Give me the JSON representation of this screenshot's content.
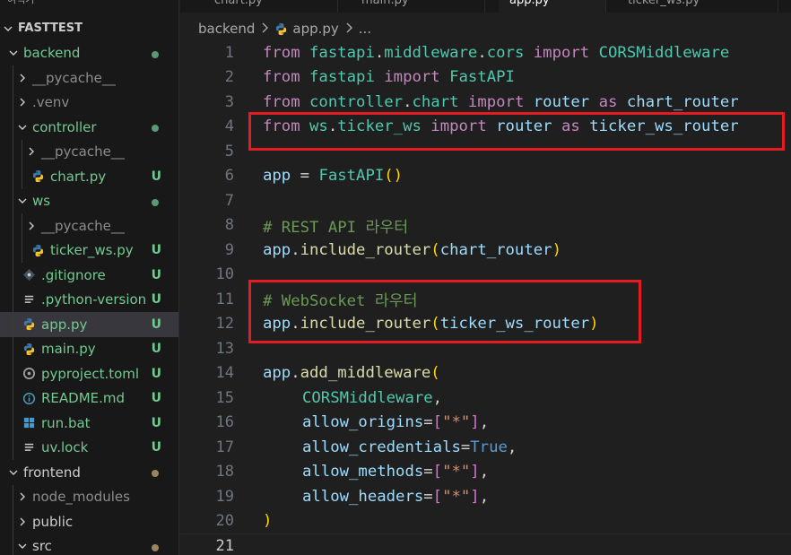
{
  "sidebar": {
    "top_partial": "여택기",
    "items": [
      {
        "label": "FASTTEST",
        "kind": "root",
        "depth": 0,
        "expanded": true
      },
      {
        "label": "backend",
        "kind": "folder",
        "depth": 1,
        "expanded": true,
        "badge": "dot"
      },
      {
        "label": "__pycache__",
        "kind": "folder",
        "depth": 2,
        "expanded": false,
        "style": "ignored"
      },
      {
        "label": ".venv",
        "kind": "folder",
        "depth": 2,
        "expanded": false,
        "style": "ignored"
      },
      {
        "label": "controller",
        "kind": "folder",
        "depth": 2,
        "expanded": true,
        "badge": "dot"
      },
      {
        "label": "__pycache__",
        "kind": "folder",
        "depth": 3,
        "expanded": false,
        "style": "ignored"
      },
      {
        "label": "chart.py",
        "kind": "python",
        "depth": 3,
        "badge": "U"
      },
      {
        "label": "ws",
        "kind": "folder",
        "depth": 2,
        "expanded": true,
        "badge": "dot"
      },
      {
        "label": "__pycache__",
        "kind": "folder",
        "depth": 3,
        "expanded": false,
        "style": "ignored"
      },
      {
        "label": "ticker_ws.py",
        "kind": "python",
        "depth": 3,
        "badge": "U"
      },
      {
        "label": ".gitignore",
        "kind": "gitignore",
        "depth": 2,
        "badge": "U"
      },
      {
        "label": ".python-version",
        "kind": "text",
        "depth": 2,
        "badge": "U"
      },
      {
        "label": "app.py",
        "kind": "python",
        "depth": 2,
        "badge": "U",
        "selected": true
      },
      {
        "label": "main.py",
        "kind": "python",
        "depth": 2,
        "badge": "U"
      },
      {
        "label": "pyproject.toml",
        "kind": "toml",
        "depth": 2,
        "badge": "U"
      },
      {
        "label": "README.md",
        "kind": "info",
        "depth": 2,
        "badge": "U"
      },
      {
        "label": "run.bat",
        "kind": "windows",
        "depth": 2,
        "badge": "U"
      },
      {
        "label": "uv.lock",
        "kind": "text",
        "depth": 2,
        "badge": "U"
      },
      {
        "label": "frontend",
        "kind": "folder",
        "depth": 1,
        "expanded": true,
        "badge": "dot-brown",
        "style": "plain"
      },
      {
        "label": "node_modules",
        "kind": "folder",
        "depth": 2,
        "expanded": false,
        "style": "ignored"
      },
      {
        "label": "public",
        "kind": "folder",
        "depth": 2,
        "expanded": false,
        "style": "plain"
      },
      {
        "label": "src",
        "kind": "folder",
        "depth": 2,
        "expanded": true,
        "badge": "dot-brown",
        "style": "plain"
      }
    ]
  },
  "tabs": [
    {
      "label": "chart.py",
      "active": false
    },
    {
      "label": "main.py",
      "active": false
    },
    {
      "label": "app.py",
      "active": true
    },
    {
      "label": "ticker_ws.py",
      "active": false
    }
  ],
  "breadcrumb": {
    "folder": "backend",
    "file": "app.py",
    "more": "..."
  },
  "editor": {
    "current_line": 21,
    "lines": [
      [
        [
          "kw",
          "from"
        ],
        [
          "plain",
          " "
        ],
        [
          "mod",
          "fastapi"
        ],
        [
          "op",
          "."
        ],
        [
          "mod",
          "middleware"
        ],
        [
          "op",
          "."
        ],
        [
          "mod",
          "cors"
        ],
        [
          "plain",
          " "
        ],
        [
          "kw",
          "import"
        ],
        [
          "plain",
          " "
        ],
        [
          "cls",
          "CORSMiddleware"
        ]
      ],
      [
        [
          "kw",
          "from"
        ],
        [
          "plain",
          " "
        ],
        [
          "mod",
          "fastapi"
        ],
        [
          "plain",
          " "
        ],
        [
          "kw",
          "import"
        ],
        [
          "plain",
          " "
        ],
        [
          "cls",
          "FastAPI"
        ]
      ],
      [
        [
          "kw",
          "from"
        ],
        [
          "plain",
          " "
        ],
        [
          "mod",
          "controller"
        ],
        [
          "op",
          "."
        ],
        [
          "mod",
          "chart"
        ],
        [
          "plain",
          " "
        ],
        [
          "kw",
          "import"
        ],
        [
          "plain",
          " "
        ],
        [
          "var",
          "router"
        ],
        [
          "plain",
          " "
        ],
        [
          "kw",
          "as"
        ],
        [
          "plain",
          " "
        ],
        [
          "var",
          "chart_router"
        ]
      ],
      [
        [
          "kw",
          "from"
        ],
        [
          "plain",
          " "
        ],
        [
          "mod",
          "ws"
        ],
        [
          "op",
          "."
        ],
        [
          "mod",
          "ticker_ws"
        ],
        [
          "plain",
          " "
        ],
        [
          "kw",
          "import"
        ],
        [
          "plain",
          " "
        ],
        [
          "var",
          "router"
        ],
        [
          "plain",
          " "
        ],
        [
          "kw",
          "as"
        ],
        [
          "plain",
          " "
        ],
        [
          "var",
          "ticker_ws_router"
        ]
      ],
      [],
      [
        [
          "var",
          "app"
        ],
        [
          "op",
          " = "
        ],
        [
          "cls",
          "FastAPI"
        ],
        [
          "p1",
          "()"
        ]
      ],
      [],
      [
        [
          "cm",
          "# REST API 라우터"
        ]
      ],
      [
        [
          "var",
          "app"
        ],
        [
          "op",
          "."
        ],
        [
          "fn",
          "include_router"
        ],
        [
          "p1",
          "("
        ],
        [
          "var",
          "chart_router"
        ],
        [
          "p1",
          ")"
        ]
      ],
      [],
      [
        [
          "cm",
          "# WebSocket 라우터"
        ]
      ],
      [
        [
          "var",
          "app"
        ],
        [
          "op",
          "."
        ],
        [
          "fn",
          "include_router"
        ],
        [
          "p1",
          "("
        ],
        [
          "var",
          "ticker_ws_router"
        ],
        [
          "p1",
          ")"
        ]
      ],
      [],
      [
        [
          "var",
          "app"
        ],
        [
          "op",
          "."
        ],
        [
          "fn",
          "add_middleware"
        ],
        [
          "p1",
          "("
        ]
      ],
      [
        [
          "indent",
          ""
        ],
        [
          "cls",
          "CORSMiddleware"
        ],
        [
          "op",
          ","
        ]
      ],
      [
        [
          "indent",
          ""
        ],
        [
          "var",
          "allow_origins"
        ],
        [
          "op",
          "="
        ],
        [
          "p2",
          "["
        ],
        [
          "str",
          "\"*\""
        ],
        [
          "p2",
          "]"
        ],
        [
          "op",
          ","
        ]
      ],
      [
        [
          "indent",
          ""
        ],
        [
          "var",
          "allow_credentials"
        ],
        [
          "op",
          "="
        ],
        [
          "bool",
          "True"
        ],
        [
          "op",
          ","
        ]
      ],
      [
        [
          "indent",
          ""
        ],
        [
          "var",
          "allow_methods"
        ],
        [
          "op",
          "="
        ],
        [
          "p2",
          "["
        ],
        [
          "str",
          "\"*\""
        ],
        [
          "p2",
          "]"
        ],
        [
          "op",
          ","
        ]
      ],
      [
        [
          "indent",
          ""
        ],
        [
          "var",
          "allow_headers"
        ],
        [
          "op",
          "="
        ],
        [
          "p2",
          "["
        ],
        [
          "str",
          "\"*\""
        ],
        [
          "p2",
          "]"
        ],
        [
          "op",
          ","
        ]
      ],
      [
        [
          "p1",
          ")"
        ]
      ],
      []
    ]
  },
  "colors": {
    "highlight_box": "#e51b23",
    "untracked": "#73c991",
    "keyword": "#c586c0",
    "class": "#4ec9b0",
    "variable": "#9cdcfe",
    "function": "#dcdcaa",
    "comment": "#6a9955",
    "string": "#ce9178"
  }
}
